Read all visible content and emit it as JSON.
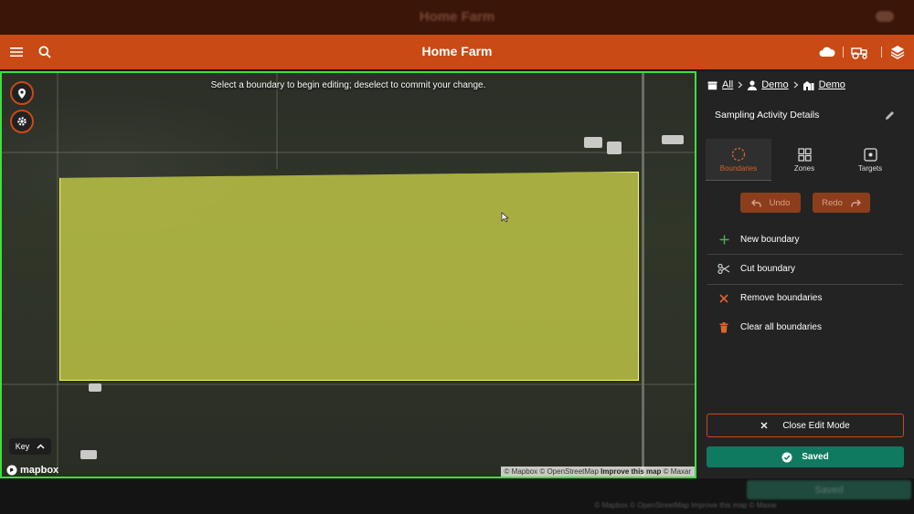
{
  "ghost": {
    "title": "Home Farm",
    "saved_label": "Saved",
    "attribution": "© Mapbox © OpenStreetMap Improve this map © Maxar"
  },
  "header": {
    "title": "Home Farm"
  },
  "map": {
    "instruction": "Select a boundary to begin editing; deselect to commit your change.",
    "key_label": "Key",
    "logo": "mapbox",
    "attribution": {
      "mapbox": "© Mapbox",
      "osm": "© OpenStreetMap",
      "improve": "Improve this map",
      "maxar": "© Maxar"
    }
  },
  "panel": {
    "breadcrumb": [
      "All",
      "Demo",
      "Demo"
    ],
    "title": "Sampling Activity Details",
    "tabs": [
      {
        "label": "Boundaries",
        "icon": "dashed-circle-icon",
        "active": true
      },
      {
        "label": "Zones",
        "icon": "grid-icon",
        "active": false
      },
      {
        "label": "Targets",
        "icon": "target-icon",
        "active": false
      }
    ],
    "undo_label": "Undo",
    "redo_label": "Redo",
    "actions": [
      {
        "label": "New boundary",
        "icon": "plus-icon"
      },
      {
        "label": "Cut boundary",
        "icon": "scissors-icon"
      },
      {
        "label": "Remove boundaries",
        "icon": "x-icon"
      },
      {
        "label": "Clear all boundaries",
        "icon": "trash-icon"
      }
    ],
    "close_label": "Close Edit Mode",
    "saved_label": "Saved"
  },
  "colors": {
    "brand": "#c94a15",
    "boundary": "#d6dd4b",
    "map_border": "#3ee03e",
    "saved": "#0f7a5f",
    "panel": "#232323"
  }
}
